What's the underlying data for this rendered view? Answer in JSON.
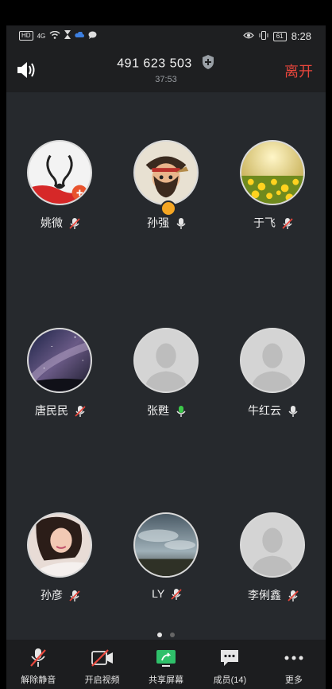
{
  "status_bar": {
    "hd": "HD",
    "signal": "4G",
    "battery": "61",
    "time": "8:28"
  },
  "header": {
    "meeting_id": "491 623 503",
    "duration": "37:53",
    "leave_label": "离开"
  },
  "participants": [
    {
      "name": "姚微",
      "mic": "muted",
      "avatar": "swans-photo"
    },
    {
      "name": "孙强",
      "mic": "on",
      "avatar": "pirate-photo",
      "host": true
    },
    {
      "name": "于飞",
      "mic": "muted",
      "avatar": "flowers-photo"
    },
    {
      "name": "唐民民",
      "mic": "muted",
      "avatar": "galaxy-photo"
    },
    {
      "name": "张甦",
      "mic": "speaking",
      "avatar": "default-avatar"
    },
    {
      "name": "牛红云",
      "mic": "on",
      "avatar": "default-avatar"
    },
    {
      "name": "孙彦",
      "mic": "muted",
      "avatar": "portrait-photo"
    },
    {
      "name": "LY",
      "mic": "muted",
      "avatar": "sky-photo"
    },
    {
      "name": "李俐鑫",
      "mic": "muted",
      "avatar": "default-avatar"
    }
  ],
  "pagination": {
    "pages": 2,
    "current": 1
  },
  "toolbar": {
    "unmute_label": "解除静音",
    "video_label": "开启视频",
    "share_label": "共享屏幕",
    "members_label": "成员(14)",
    "more_label": "更多"
  },
  "colors": {
    "leave": "#e8463c",
    "speaking_mic": "#3cc84a",
    "muted_slash": "#e8463c",
    "share_icon": "#2fc06a"
  }
}
